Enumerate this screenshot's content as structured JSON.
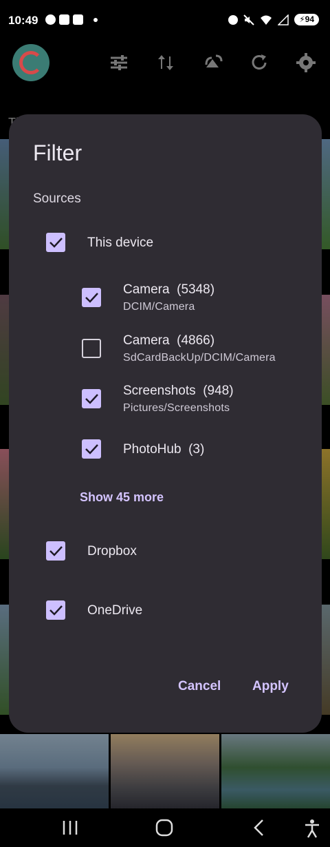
{
  "status_bar": {
    "time": "10:49",
    "battery": "94",
    "icons_left": [
      "account-icon",
      "app-icon",
      "app-icon",
      "dot-icon"
    ],
    "icons_right": [
      "dnd-icon",
      "mute-icon",
      "wifi-icon",
      "signal-icon",
      "battery-icon"
    ]
  },
  "toolbar": {
    "icons": [
      "app-logo",
      "tune-icon",
      "sort-icon",
      "swap-icon",
      "refresh-icon",
      "gear-icon"
    ]
  },
  "background": {
    "section_header_partial": "Th"
  },
  "dialog": {
    "title": "Filter",
    "section_label": "Sources",
    "sources": [
      {
        "label": "This device",
        "checked": true
      },
      {
        "label": "Dropbox",
        "checked": true
      },
      {
        "label": "OneDrive",
        "checked": true
      }
    ],
    "folders": [
      {
        "name": "Camera",
        "count": "(5348)",
        "path": "DCIM/Camera",
        "checked": true
      },
      {
        "name": "Camera",
        "count": "(4866)",
        "path": "SdCardBackUp/DCIM/Camera",
        "checked": false
      },
      {
        "name": "Screenshots",
        "count": "(948)",
        "path": "Pictures/Screenshots",
        "checked": true
      },
      {
        "name": "PhotoHub",
        "count": "(3)",
        "path": "",
        "checked": true
      }
    ],
    "show_more": "Show 45 more",
    "cancel": "Cancel",
    "apply": "Apply"
  },
  "colors": {
    "dialog_bg": "#2f2c33",
    "accent": "#cdbfff",
    "accent_text": "#d4c4ff"
  }
}
